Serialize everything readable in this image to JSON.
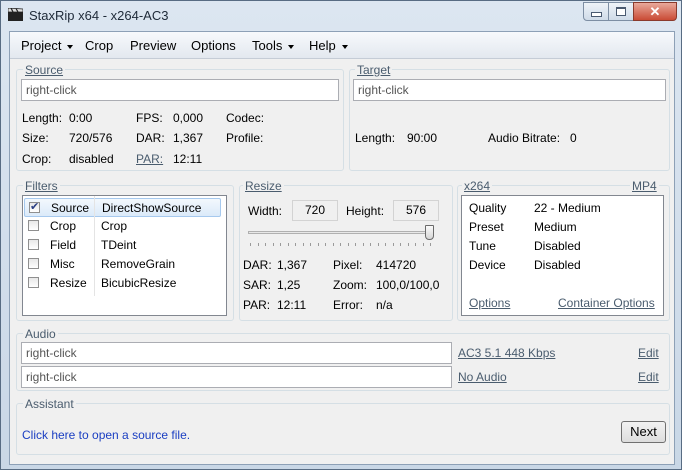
{
  "window": {
    "title": "StaxRip x64 - x264-AC3"
  },
  "menu": [
    {
      "label": "Project",
      "has_arrow": true
    },
    {
      "label": "Crop",
      "has_arrow": false
    },
    {
      "label": "Preview",
      "has_arrow": false
    },
    {
      "label": "Options",
      "has_arrow": false
    },
    {
      "label": "Tools",
      "has_arrow": true
    },
    {
      "label": "Help",
      "has_arrow": true
    }
  ],
  "source": {
    "group_label": "Source",
    "file_value": "right-click",
    "length_label": "Length:",
    "length_value": "0:00",
    "fps_label": "FPS:",
    "fps_value": "0,000",
    "codec_label": "Codec:",
    "size_label": "Size:",
    "size_value": "720/576",
    "dar_label": "DAR:",
    "dar_value": "1,367",
    "profile_label": "Profile:",
    "crop_label": "Crop:",
    "crop_value": "disabled",
    "par_label": "PAR:",
    "par_value": "12:11"
  },
  "target": {
    "group_label": "Target",
    "file_value": "right-click",
    "length_label": "Length:",
    "length_value": "90:00",
    "bitrate_label": "Audio Bitrate:",
    "bitrate_value": "0"
  },
  "filters": {
    "group_label": "Filters",
    "items": [
      {
        "category": "Source",
        "name": "DirectShowSource",
        "checked": true
      },
      {
        "category": "Crop",
        "name": "Crop",
        "checked": false
      },
      {
        "category": "Field",
        "name": "TDeint",
        "checked": false
      },
      {
        "category": "Misc",
        "name": "RemoveGrain",
        "checked": false
      },
      {
        "category": "Resize",
        "name": "BicubicResize",
        "checked": false
      }
    ]
  },
  "resize": {
    "group_label": "Resize",
    "width_label": "Width:",
    "width_value": "720",
    "height_label": "Height:",
    "height_value": "576",
    "slider_level": 1.0,
    "dar_label": "DAR:",
    "dar_value": "1,367",
    "pixel_label": "Pixel:",
    "pixel_value": "414720",
    "sar_label": "SAR:",
    "sar_value": "1,25",
    "zoom_label": "Zoom:",
    "zoom_value": "100,0/100,0",
    "par_label": "PAR:",
    "par_value": "12:11",
    "error_label": "Error:",
    "error_value": "n/a"
  },
  "encoder": {
    "group_label": "x264",
    "container_label": "MP4",
    "rows": [
      {
        "key": "Quality",
        "value": "22 - Medium"
      },
      {
        "key": "Preset",
        "value": "Medium"
      },
      {
        "key": "Tune",
        "value": "Disabled"
      },
      {
        "key": "Device",
        "value": "Disabled"
      }
    ],
    "options_link": "Options",
    "container_options_link": "Container Options"
  },
  "audio": {
    "group_label": "Audio",
    "track1_value": "right-click",
    "track1_profile": "AC3 5.1 448 Kbps",
    "track1_edit": "Edit",
    "track2_value": "right-click",
    "track2_profile": "No Audio",
    "track2_edit": "Edit"
  },
  "assistant": {
    "group_label": "Assistant",
    "message": "Click here to open a source file.",
    "next_label": "Next"
  },
  "colors": {
    "link_blue": "#1a3ec2",
    "group_label": "#4a5c6e",
    "close_red": "#c94b35"
  }
}
